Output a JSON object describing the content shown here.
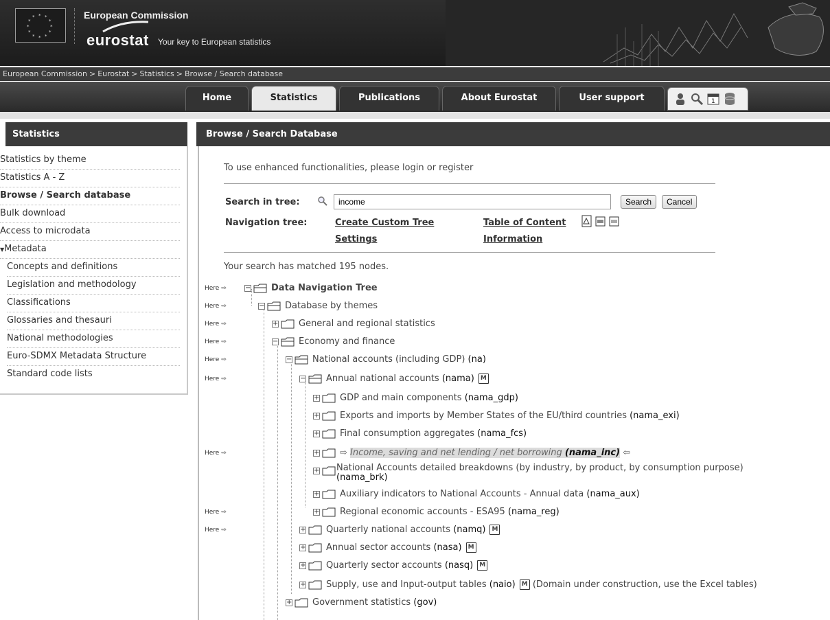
{
  "header": {
    "org": "European Commission",
    "brand": "eurostat",
    "tagline": "Your key to European statistics"
  },
  "breadcrumb": [
    "European Commission",
    "Eurostat",
    "Statistics",
    "Browse / Search database"
  ],
  "nav": {
    "tabs": [
      "Home",
      "Statistics",
      "Publications",
      "About Eurostat",
      "User support"
    ],
    "active": "Statistics"
  },
  "left_panel": {
    "title": "Statistics",
    "items": [
      "Statistics by theme",
      "Statistics A - Z",
      "Browse / Search database",
      "Bulk download",
      "Access to microdata"
    ],
    "metadata_label": "Metadata",
    "metadata_items": [
      "Concepts and definitions",
      "Legislation and methodology",
      "Classifications",
      "Glossaries and thesauri",
      "National methodologies",
      "Euro-SDMX Metadata Structure",
      "Standard code lists"
    ]
  },
  "main": {
    "title": "Browse / Search Database",
    "login_note": "To use enhanced functionalities, please login or register",
    "search_label": "Search in tree:",
    "search_value": "income",
    "search_button": "Search",
    "cancel_button": "Cancel",
    "nav_tree_label": "Navigation tree:",
    "link_custom_tree": "Create Custom Tree",
    "link_settings": "Settings",
    "link_toc": "Table of Content",
    "link_information": "Information",
    "matched": "Your search has matched 195 nodes.",
    "here": "Here"
  },
  "tree": [
    {
      "name": "Data Navigation Tree",
      "code": ""
    },
    {
      "name": "Database by themes",
      "code": ""
    },
    {
      "name": "General and regional statistics",
      "code": ""
    },
    {
      "name": "Economy and finance",
      "code": ""
    },
    {
      "name": "National accounts (including GDP)",
      "code": "(na)"
    },
    {
      "name": "Annual national accounts",
      "code": "(nama)"
    },
    {
      "name": "GDP and main components",
      "code": "(nama_gdp)"
    },
    {
      "name": "Exports and imports by Member States of the EU/third countries",
      "code": "(nama_exi)"
    },
    {
      "name": "Final consumption aggregates",
      "code": "(nama_fcs)"
    },
    {
      "name": "Income, saving and net lending / net borrowing",
      "code": "(nama_inc)"
    },
    {
      "name": "National Accounts detailed breakdowns (by industry, by product, by consumption purpose)",
      "code": "(nama_brk)"
    },
    {
      "name": "Auxiliary indicators to National Accounts - Annual data",
      "code": "(nama_aux)"
    },
    {
      "name": "Regional economic accounts - ESA95",
      "code": "(nama_reg)"
    },
    {
      "name": "Quarterly national accounts",
      "code": "(namq)"
    },
    {
      "name": "Annual sector accounts",
      "code": "(nasa)"
    },
    {
      "name": "Quarterly sector accounts",
      "code": "(nasq)"
    },
    {
      "name": "Supply, use and Input-output tables",
      "code": "(naio)",
      "note": "(Domain under construction, use the Excel tables)"
    },
    {
      "name": "Government statistics",
      "code": "(gov)"
    }
  ]
}
